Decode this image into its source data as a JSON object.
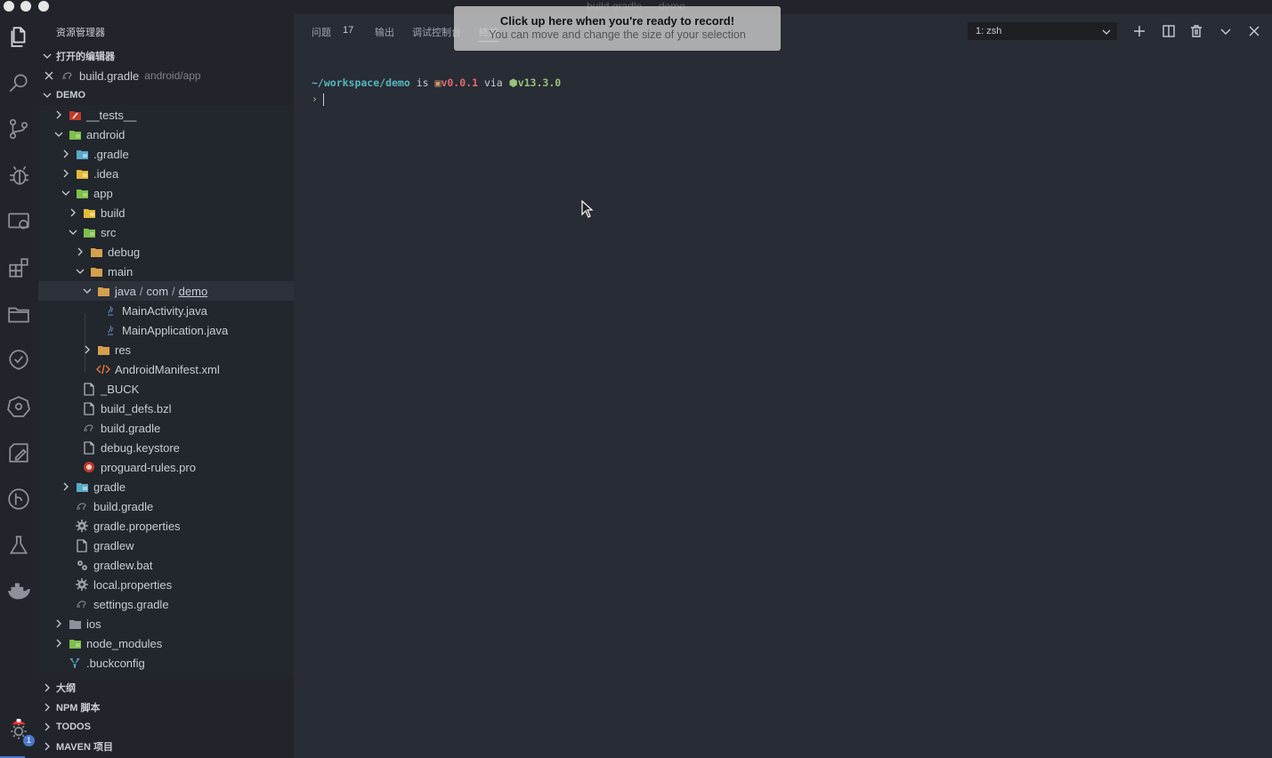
{
  "window": {
    "title": "build.gradle — demo"
  },
  "explorer": {
    "title": "资源管理器",
    "open_editors_label": "打开的编辑器",
    "open_editor": {
      "name": "build.gradle",
      "path": "android/app"
    },
    "root_label": "DEMO",
    "tree": [
      {
        "label": "__tests__"
      },
      {
        "label": "android"
      },
      {
        "label": ".gradle"
      },
      {
        "label": ".idea"
      },
      {
        "label": "app"
      },
      {
        "label": "build"
      },
      {
        "label": "src"
      },
      {
        "label": "debug"
      },
      {
        "label": "main"
      },
      {
        "label_parts": [
          "java",
          "com",
          "demo"
        ]
      },
      {
        "label": "MainActivity.java"
      },
      {
        "label": "MainApplication.java"
      },
      {
        "label": "res"
      },
      {
        "label": "AndroidManifest.xml"
      },
      {
        "label": "_BUCK"
      },
      {
        "label": "build_defs.bzl"
      },
      {
        "label": "build.gradle"
      },
      {
        "label": "debug.keystore"
      },
      {
        "label": "proguard-rules.pro"
      },
      {
        "label": "gradle"
      },
      {
        "label": "build.gradle"
      },
      {
        "label": "gradle.properties"
      },
      {
        "label": "gradlew"
      },
      {
        "label": "gradlew.bat"
      },
      {
        "label": "local.properties"
      },
      {
        "label": "settings.gradle"
      },
      {
        "label": "ios"
      },
      {
        "label": "node_modules"
      },
      {
        "label": ".buckconfig"
      }
    ],
    "bottom_sections": [
      "大纲",
      "NPM 脚本",
      "TODOS",
      "MAVEN 项目"
    ]
  },
  "activity_bar": {
    "badge_count": "1"
  },
  "panel": {
    "tabs": [
      {
        "label": "问题",
        "count": "17"
      },
      {
        "label": "输出"
      },
      {
        "label": "调试控制台"
      },
      {
        "label": "终端"
      }
    ],
    "terminal_select": "1: zsh",
    "terminal": {
      "path": "~/workspace/demo",
      "is": "is",
      "version": "v0.0.1",
      "via": "via",
      "node_version": "v13.3.0",
      "prompt": "›"
    }
  },
  "overlay": {
    "title": "Click up here when you're ready to record!",
    "subtitle": "You can move and change the size of your selection"
  },
  "colors": {
    "accent": "#4d78cc",
    "terminal_path": "#56b6c2",
    "terminal_version": "#e06c75",
    "terminal_node": "#98c379"
  }
}
